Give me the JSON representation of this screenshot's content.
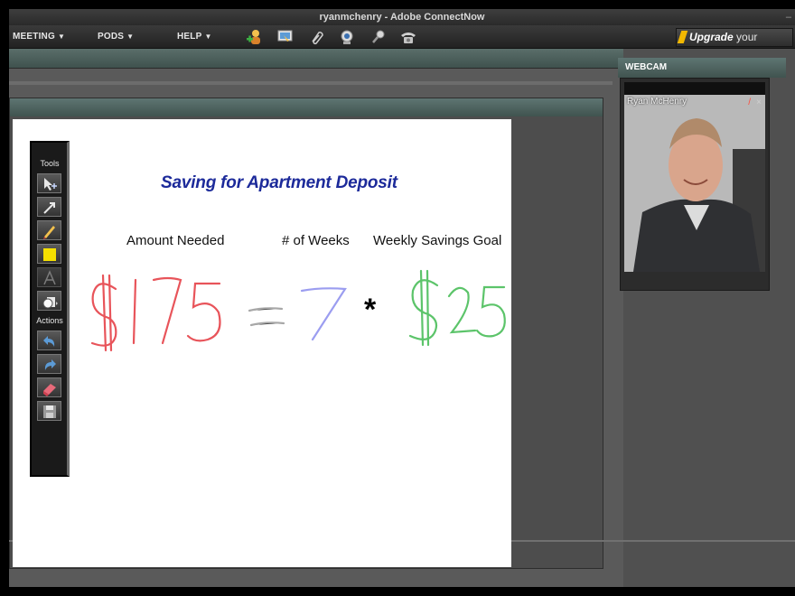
{
  "window": {
    "title": "ryanmchenry - Adobe ConnectNow",
    "minimize": "–"
  },
  "menubar": {
    "items": [
      {
        "label": "MEETING",
        "arrow": "▼"
      },
      {
        "label": "PODS",
        "arrow": "▼"
      },
      {
        "label": "HELP",
        "arrow": "▼"
      }
    ],
    "toolbar_icons": [
      "add-user-icon",
      "share-screen-icon",
      "attachment-icon",
      "webcam-icon",
      "microphone-icon",
      "telephone-icon"
    ],
    "upgrade": {
      "bold": "Upgrade",
      "rest": " your Meeting"
    }
  },
  "whiteboard_tools": {
    "tools_label": "Tools",
    "actions_label": "Actions",
    "tools": [
      "selection-icon",
      "line-icon",
      "pencil-icon",
      "sticky-note-icon",
      "text-icon",
      "shapes-icon"
    ],
    "actions": [
      "undo-icon",
      "redo-icon",
      "eraser-icon",
      "save-icon"
    ]
  },
  "whiteboard": {
    "title": "Saving for Apartment Deposit",
    "labels": [
      "Amount Needed",
      "# of Weeks",
      "Weekly Savings Goal"
    ],
    "ink": {
      "amount": "$175",
      "equals": "=",
      "weeks": "7",
      "times": "*",
      "goal": "$25",
      "colors": {
        "amount": "#e8545a",
        "equals": "#a0a0a0",
        "weeks": "#9b9df0",
        "times": "#000000",
        "goal": "#5cc46a"
      }
    }
  },
  "webcam": {
    "header": "WEBCAM",
    "name": "Ryan McHenry",
    "controls": [
      "/",
      "×"
    ]
  },
  "colors": {
    "pod_header": "#4a5f5b",
    "title_text": "#1c2a9a",
    "upgrade_badge": "#f2b800"
  }
}
